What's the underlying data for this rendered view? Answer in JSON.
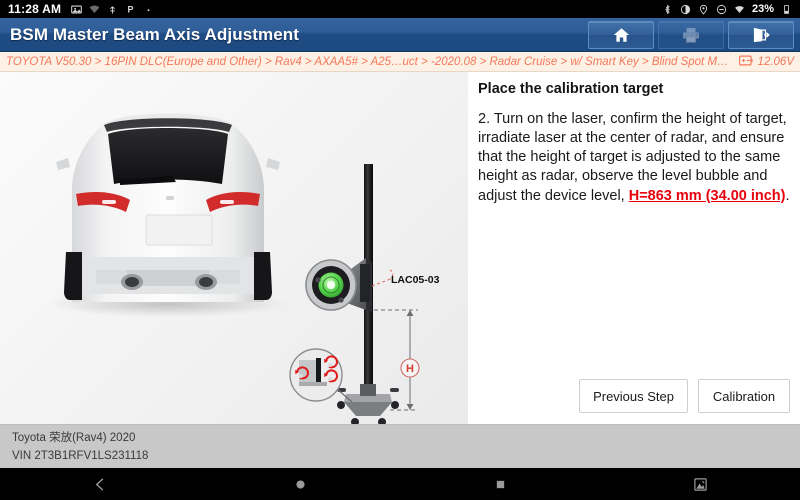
{
  "statusbar": {
    "time": "11:28 AM",
    "left_icons": [
      "screenshot-icon",
      "signal-icon",
      "usb-icon",
      "parking-icon",
      "dot-icon"
    ],
    "right_icons": [
      "bluetooth-icon",
      "brightness-icon",
      "location-icon",
      "do-not-disturb-icon",
      "wifi-icon"
    ],
    "battery_percent": "23%",
    "battery_icon": "battery-icon"
  },
  "titlebar": {
    "title": "BSM Master Beam Axis Adjustment",
    "buttons": [
      {
        "name": "home-button",
        "icon": "home-icon",
        "enabled": true
      },
      {
        "name": "print-button",
        "icon": "printer-icon",
        "enabled": false
      },
      {
        "name": "exit-button",
        "icon": "exit-icon",
        "enabled": true
      }
    ]
  },
  "breadcrumb": {
    "path": "TOYOTA V50.30 > 16PIN DLC(Europe and Other) > Rav4 > AXAA5# > A25…uct > -2020.08 > Radar Cruise > w/ Smart Key > Blind Spot Monitor Master",
    "segments": [
      "TOYOTA V50.30",
      "16PIN DLC(Europe and Other)",
      "Rav4",
      "AXAA5#",
      "A25…uct",
      "-2020.08",
      "Radar Cruise",
      "w/ Smart Key",
      "Blind Spot Monitor Master"
    ],
    "voltage": "12.06V",
    "voltage_icon": "battery-voltage-icon"
  },
  "content": {
    "heading": "Place the calibration target",
    "paragraph_prefix": "2. Turn on the laser, confirm the height of target, irradiate laser at the center of radar, and ensure that the height of target is adjusted to the same height as radar, observe the level bubble and adjust the device level, ",
    "highlight": "H=863 mm (34.00 inch)",
    "paragraph_suffix": ".",
    "highlight_color": "#e8000d"
  },
  "diagram": {
    "device_label": "LAC05-03",
    "height_marker": "H",
    "vehicle_view": "rear-view-suv",
    "callouts": [
      "bubble-level-magnifier",
      "base-adjuster-magnifier"
    ]
  },
  "actions": {
    "previous_step": "Previous Step",
    "calibration": "Calibration"
  },
  "footer": {
    "vehicle": "Toyota 荣放(Rav4) 2020",
    "vin": "VIN 2T3B1RFV1LS231118"
  },
  "navbar": {
    "buttons": [
      "back-icon",
      "home-circle-icon",
      "recents-square-icon",
      "screenshot-icon"
    ]
  },
  "colors": {
    "title_blue": "#2e5d97",
    "breadcrumb_bg": "#fdf0e4",
    "breadcrumb_text": "#f4795b",
    "accent_red": "#e8000d",
    "footer_bg": "#c8c8c8"
  }
}
